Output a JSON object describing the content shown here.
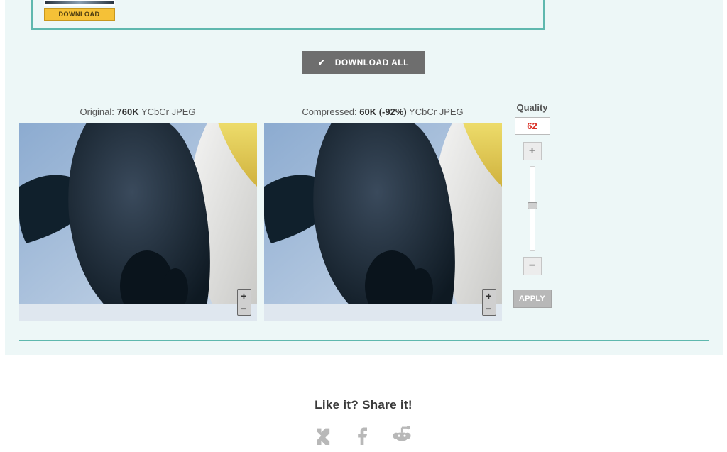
{
  "thumbnail": {
    "download_label": "DOWNLOAD"
  },
  "download_all": {
    "label": "DOWNLOAD ALL"
  },
  "original": {
    "prefix": "Original: ",
    "size": "760K",
    "format": " YCbCr JPEG"
  },
  "compressed": {
    "prefix": "Compressed: ",
    "size": "60K ",
    "savings": "(-92%)",
    "format": " YCbCr JPEG"
  },
  "zoom": {
    "in": "+",
    "out": "−"
  },
  "quality": {
    "title": "Quality",
    "value": "62",
    "plus": "+",
    "minus": "−",
    "apply": "APPLY",
    "slider_pct": 42
  },
  "share": {
    "title": "Like it? Share it!"
  }
}
